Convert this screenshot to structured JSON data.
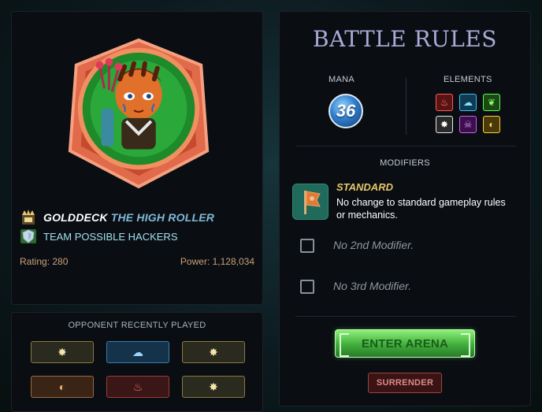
{
  "player": {
    "name_first": "GOLDDECK",
    "name_title": "THE HIGH ROLLER",
    "team": "TEAM POSSIBLE HACKERS",
    "rating": "Rating: 280",
    "power": "Power: 1,128,034",
    "rank_icon": "crown-rank-icon",
    "guild_icon": "shield-guild-icon"
  },
  "opponent": {
    "title": "OPPONENT RECENTLY PLAYED",
    "played": [
      {
        "element": "neutral",
        "glyph": "✸"
      },
      {
        "element": "water",
        "glyph": "☁"
      },
      {
        "element": "neutral",
        "glyph": "✸"
      },
      {
        "element": "earth",
        "glyph": "◐"
      },
      {
        "element": "fire",
        "glyph": "♨"
      },
      {
        "element": "neutral",
        "glyph": "✸"
      }
    ]
  },
  "rules": {
    "title": "BATTLE RULES",
    "mana_label": "MANA",
    "mana_value": "36",
    "elements_label": "ELEMENTS",
    "elements": [
      {
        "name": "fire",
        "glyph": "♨"
      },
      {
        "name": "water",
        "glyph": "☁"
      },
      {
        "name": "earth",
        "glyph": "❦"
      },
      {
        "name": "life",
        "glyph": "✸"
      },
      {
        "name": "death",
        "glyph": "☠"
      },
      {
        "name": "dragon",
        "glyph": "◐"
      }
    ],
    "modifiers_label": "MODIFIERS",
    "modifier_name": "STANDARD",
    "modifier_desc": "No change to standard gameplay rules or mechanics.",
    "no_mod_2": "No 2nd Modifier.",
    "no_mod_3": "No 3rd Modifier.",
    "enter_label": "ENTER ARENA",
    "surrender_label": "SURRENDER"
  }
}
